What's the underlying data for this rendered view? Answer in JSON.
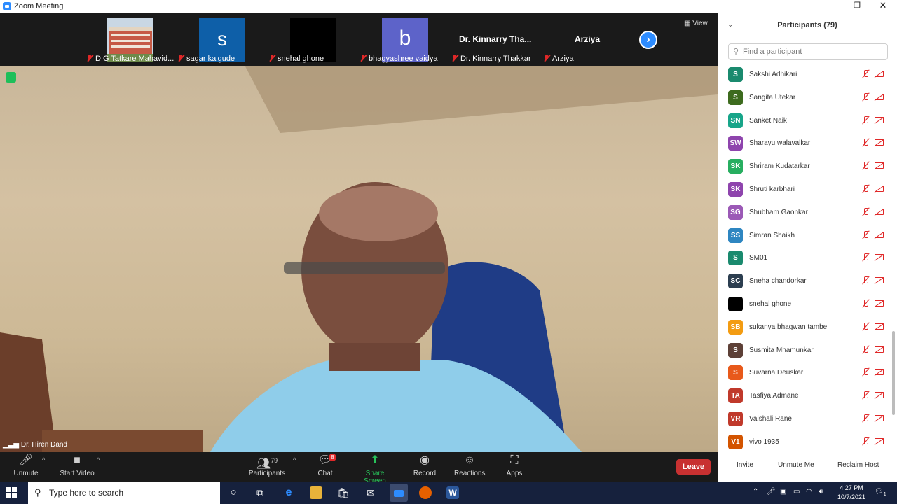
{
  "window": {
    "title": "Zoom Meeting",
    "min": "—",
    "max": "❐",
    "close": "✕"
  },
  "strip": {
    "tiles": [
      {
        "label": "D G Tatkare Mahavid..."
      },
      {
        "label": "sagar kalgude",
        "initial": "s",
        "color": "#0e5fa8"
      },
      {
        "label": "snehal ghone",
        "color": "#000000"
      },
      {
        "label": "bhagyashree vaidya",
        "initial": "b",
        "color": "#5d63c9"
      },
      {
        "label": "Dr. Kinnarry Thakkar",
        "display": "Dr. Kinnarry Tha..."
      },
      {
        "label": "Arziya",
        "display": "Arziya"
      }
    ],
    "next": "›",
    "view_label": "View"
  },
  "main": {
    "speaker": "Dr. Hiren Dand"
  },
  "toolbar": {
    "unmute": "Unmute",
    "start_video": "Start Video",
    "participants": "Participants",
    "participants_count": "79",
    "chat": "Chat",
    "chat_badge": "8",
    "share": "Share Screen",
    "record": "Record",
    "reactions": "Reactions",
    "apps": "Apps",
    "leave": "Leave"
  },
  "panel": {
    "title": "Participants (79)",
    "search_placeholder": "Find a participant",
    "participants": [
      {
        "initials": "S",
        "name": "Sakshi Adhikari",
        "color": "#1a8a6e"
      },
      {
        "initials": "S",
        "name": "Sangita Utekar",
        "color": "#3d6b1e"
      },
      {
        "initials": "SN",
        "name": "Sanket Naik",
        "color": "#17a589"
      },
      {
        "initials": "SW",
        "name": "Sharayu walavalkar",
        "color": "#8e44ad"
      },
      {
        "initials": "SK",
        "name": "Shriram Kudatarkar",
        "color": "#27ae60"
      },
      {
        "initials": "SK",
        "name": "Shruti karbhari",
        "color": "#8e44ad"
      },
      {
        "initials": "SG",
        "name": "Shubham Gaonkar",
        "color": "#9b59b6"
      },
      {
        "initials": "SS",
        "name": "Simran Shaikh",
        "color": "#2e86c1"
      },
      {
        "initials": "S",
        "name": "SM01",
        "color": "#1a8a6e"
      },
      {
        "initials": "SC",
        "name": "Sneha chandorkar",
        "color": "#2c3e50"
      },
      {
        "initials": "",
        "name": "snehal ghone",
        "color": "#000000"
      },
      {
        "initials": "SB",
        "name": "sukanya bhagwan tambe",
        "color": "#f39c12"
      },
      {
        "initials": "S",
        "name": "Susmita Mhamunkar",
        "color": "#5d4037"
      },
      {
        "initials": "S",
        "name": "Suvarna Deuskar",
        "color": "#e8591a"
      },
      {
        "initials": "TA",
        "name": "Tasfiya Admane",
        "color": "#c0392b"
      },
      {
        "initials": "VR",
        "name": "Vaishali Rane",
        "color": "#c0392b"
      },
      {
        "initials": "V1",
        "name": "vivo 1935",
        "color": "#d35400"
      }
    ],
    "invite": "Invite",
    "unmute_me": "Unmute Me",
    "reclaim_host": "Reclaim Host"
  },
  "taskbar": {
    "search_placeholder": "Type here to search",
    "time": "4:27 PM",
    "date": "10/7/2021",
    "notification_count": "1"
  }
}
